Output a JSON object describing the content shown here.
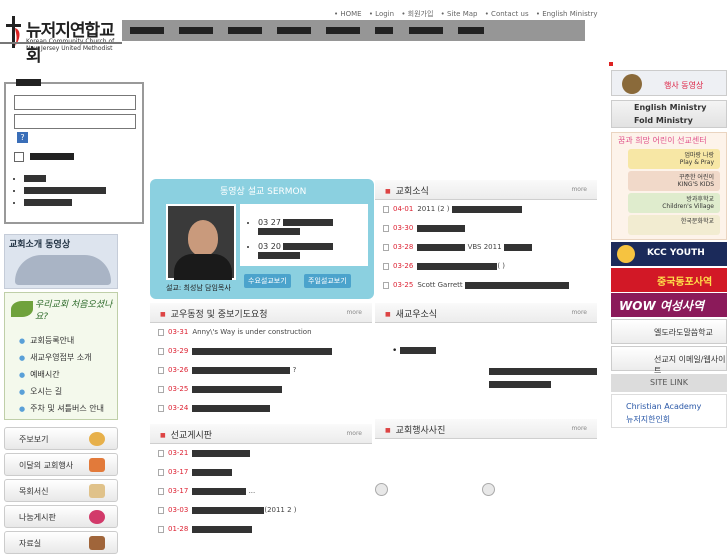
{
  "logo": {
    "name_ko": "뉴저지연합교회",
    "name_en_1": "Korean Community Church of",
    "name_en_2": "New Jersey United Methodist"
  },
  "topnav": [
    "• HOME",
    "• Login",
    "• 회원가입",
    "• Site Map",
    "• Contact us",
    "• English Ministry"
  ],
  "mainmenu_count": 8,
  "login": {
    "heading": "",
    "user_placeholder": "",
    "pass_placeholder": "",
    "help": "?",
    "remember": "",
    "links": [
      "",
      "",
      ""
    ]
  },
  "left": {
    "intro_title": "교회소개 동영상",
    "welcome_title": "우리교회 처음오셨나요?",
    "welcome_items": [
      "교회등록안내",
      "새교우영접부 소개",
      "예배시간",
      "오시는 길",
      "주차 및 셔틀버스 안내"
    ],
    "buttons": [
      "주보보기",
      "이달의 교회행사",
      "목회서신",
      "나눔게시판",
      "자료실"
    ]
  },
  "sermon": {
    "title": "동영상 설교 SERMON",
    "items": [
      "03  27",
      "03  20"
    ],
    "caption": "설교: 최성남 담임목사",
    "btn1": "수요설교보기",
    "btn2": "주일설교보기"
  },
  "sections": {
    "prayer": {
      "title": "교우동정 및 중보기도요청",
      "more": "more",
      "rows": [
        {
          "d": "03-31",
          "t": "Anny\\'s Way is under construction"
        },
        {
          "d": "03-29",
          "t": ""
        },
        {
          "d": "03-26",
          "t": "?"
        },
        {
          "d": "03-25",
          "t": ""
        },
        {
          "d": "03-24",
          "t": ""
        }
      ]
    },
    "mission": {
      "title": "선교게시판",
      "more": "more",
      "rows": [
        {
          "d": "03-21",
          "t": ""
        },
        {
          "d": "03-17",
          "t": ""
        },
        {
          "d": "03-17",
          "t": "..."
        },
        {
          "d": "03-03",
          "t": "(2011   2 )"
        },
        {
          "d": "01-28",
          "t": ""
        }
      ]
    },
    "news": {
      "title": "교회소식",
      "more": "more",
      "rows": [
        {
          "d": "04-01",
          "t": "2011       (2  )"
        },
        {
          "d": "03-30",
          "t": ""
        },
        {
          "d": "03-28",
          "t": "VBS 2011"
        },
        {
          "d": "03-26",
          "t": "( )"
        },
        {
          "d": "03-25",
          "t": "Scott Garrett"
        }
      ]
    },
    "newcomers": {
      "title": "새교우소식",
      "more": "more"
    },
    "photos": {
      "title": "교회행사사진",
      "more": "more"
    }
  },
  "right": {
    "video": "행사 동영상",
    "english": "English Ministry",
    "fold": "Fold Ministry",
    "kids_title": "꿈과 희망 어린이 선교센터",
    "kids": [
      {
        "l1": "엄마랑 나랑",
        "l2": "Play & Pray"
      },
      {
        "l1": "꾸준한 어린이",
        "l2": "KING'S KIDS"
      },
      {
        "l1": "방과후학교",
        "l2": "Children's Village"
      },
      {
        "l1": "한국문화학교",
        "l2": ""
      }
    ],
    "youth": "KCC YOUTH",
    "china": "중국동포사역",
    "wow": "WOW 여성사역",
    "bible": "엘도라도말씀학교",
    "missionary": "선교지 이메일/웹사이트",
    "site_link": "SITE LINK",
    "links": [
      "Christian Academy",
      "뉴저지한인회"
    ]
  }
}
